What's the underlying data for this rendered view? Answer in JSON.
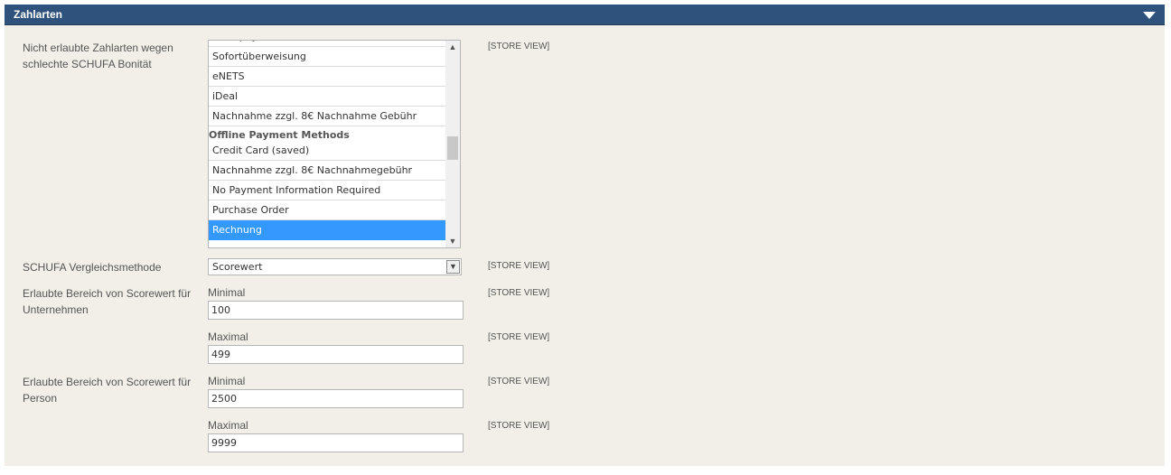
{
  "section": {
    "title": "Zahlarten"
  },
  "scope_label": "[STORE VIEW]",
  "fields": {
    "disallowed": {
      "label": "Nicht erlaubte Zahlarten wegen schlechte SCHUFA Bonität",
      "options": [
        {
          "text": "Postepay",
          "type": "option",
          "cut": true
        },
        {
          "text": "Sofortüberweisung",
          "type": "option"
        },
        {
          "text": "eNETS",
          "type": "option"
        },
        {
          "text": "iDeal",
          "type": "option"
        },
        {
          "text": "Nachnahme zzgl. 8€ Nachnahme Gebühr",
          "type": "option"
        },
        {
          "text": "Offline Payment Methods",
          "type": "group"
        },
        {
          "text": "Credit Card (saved)",
          "type": "option"
        },
        {
          "text": "Nachnahme zzgl. 8€ Nachnahmegebühr",
          "type": "option"
        },
        {
          "text": "No Payment Information Required",
          "type": "option"
        },
        {
          "text": "Purchase Order",
          "type": "option"
        },
        {
          "text": "Rechnung",
          "type": "option",
          "selected": true
        }
      ]
    },
    "method": {
      "label": "SCHUFA Vergleichsmethode",
      "value": "Scorewert"
    },
    "company_range": {
      "label": "Erlaubte Bereich von Scorewert für Unternehmen",
      "min_label": "Minimal",
      "min_value": "100",
      "max_label": "Maximal",
      "max_value": "499"
    },
    "person_range": {
      "label": "Erlaubte Bereich von Scorewert für Person",
      "min_label": "Minimal",
      "min_value": "2500",
      "max_label": "Maximal",
      "max_value": "9999"
    }
  },
  "colors": {
    "header": "#2e527b",
    "section_bg": "#f1efe8",
    "selected": "#3399ff"
  }
}
